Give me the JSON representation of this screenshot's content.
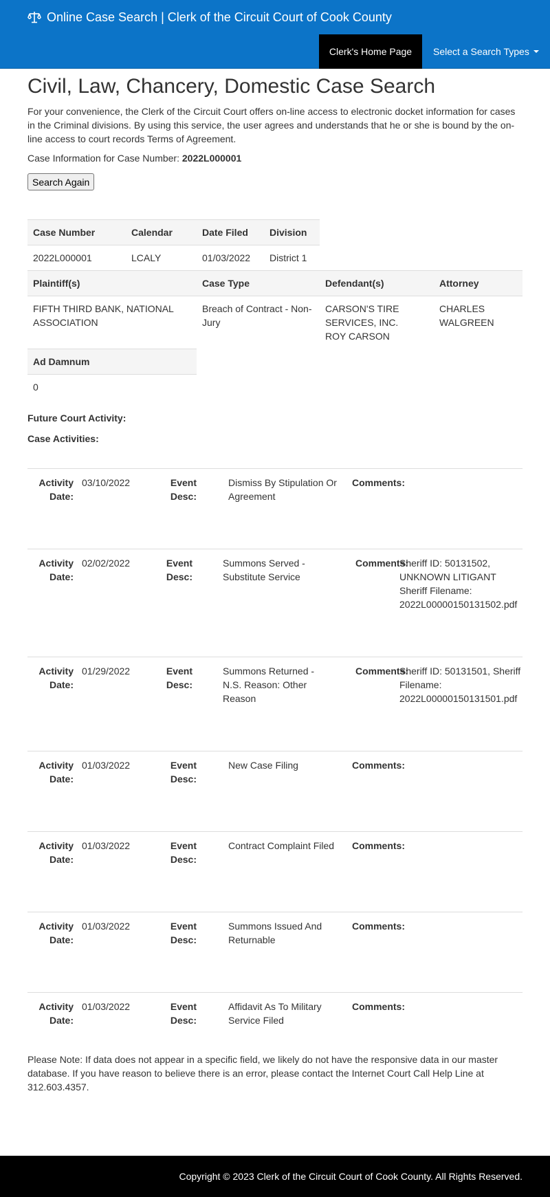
{
  "header": {
    "brand_icon": "scales-icon",
    "title": "Online Case Search | Clerk of the Circuit Court of Cook County",
    "nav_home": "Clerk's Home Page",
    "nav_search_types": "Select a Search Types"
  },
  "page": {
    "heading": "Civil, Law, Chancery, Domestic Case Search",
    "intro": "For your convenience, the Clerk of the Circuit Court offers on-line access to electronic docket information for cases in the Criminal divisions. By using this service, the user agrees and understands that he or she is bound by the on-line access to court records Terms of Agreement.",
    "case_info_label": "Case Information for Case Number:",
    "case_number": "2022L000001",
    "search_again": "Search Again"
  },
  "case_table": {
    "headers": [
      "Case Number",
      "Calendar",
      "Date Filed",
      "Division"
    ],
    "values": [
      "2022L000001",
      "LCALY",
      "01/03/2022",
      "District 1"
    ]
  },
  "parties_table": {
    "headers": [
      "Plaintiff(s)",
      "Case Type",
      "Defendant(s)",
      "Attorney"
    ],
    "plaintiff": "FIFTH THIRD BANK, NATIONAL ASSOCIATION",
    "case_type": "Breach of Contract - Non-Jury",
    "defendants": [
      "CARSON'S TIRE SERVICES, INC.",
      "ROY CARSON"
    ],
    "attorney": "CHARLES WALGREEN"
  },
  "damnum_table": {
    "header": "Ad Damnum",
    "value": "0"
  },
  "labels": {
    "future_court": "Future Court Activity:",
    "case_activities": "Case Activities:",
    "activity_date": "Activity Date:",
    "event_desc": "Event Desc:",
    "comments": "Comments:"
  },
  "activities": [
    {
      "date": "03/10/2022",
      "event": "Dismiss By Stipulation Or Agreement",
      "comments": ""
    },
    {
      "date": "02/02/2022",
      "event": "Summons Served - Substitute Service",
      "comments": "Sheriff ID: 50131502, UNKNOWN LITIGANT Sheriff Filename: 2022L00000150131502.pdf"
    },
    {
      "date": "01/29/2022",
      "event": "Summons Returned - N.S. Reason: Other Reason",
      "comments": "Sheriff ID: 50131501, Sheriff Filename: 2022L00000150131501.pdf"
    },
    {
      "date": "01/03/2022",
      "event": "New Case Filing",
      "comments": ""
    },
    {
      "date": "01/03/2022",
      "event": "Contract Complaint Filed",
      "comments": ""
    },
    {
      "date": "01/03/2022",
      "event": "Summons Issued And Returnable",
      "comments": ""
    },
    {
      "date": "01/03/2022",
      "event": "Affidavit As To Military Service Filed",
      "comments": ""
    }
  ],
  "note": "Please Note: If data does not appear in a specific field, we likely do not have the responsive data in our master database. If you have reason to believe there is an error, please contact the Internet Court Call Help Line at 312.603.4357.",
  "footer": {
    "copyright": "Copyright © 2023 Clerk of the Circuit Court of Cook County. All Rights Reserved."
  }
}
